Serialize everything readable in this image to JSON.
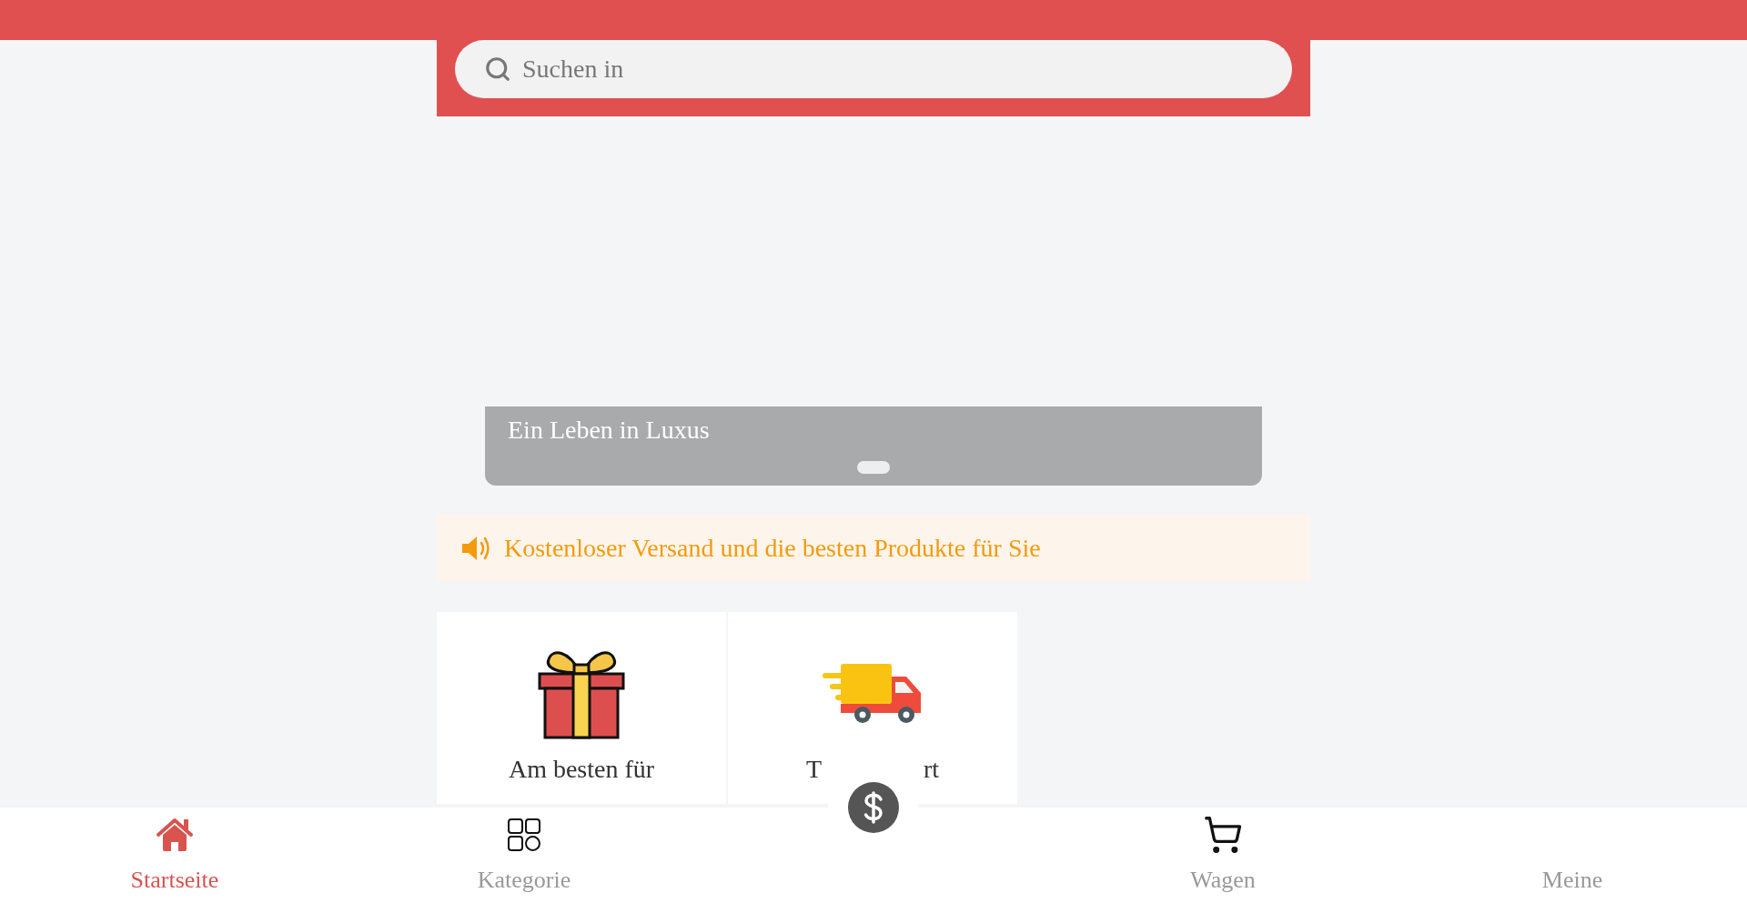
{
  "search": {
    "placeholder": "Suchen in"
  },
  "banner": {
    "caption": "Ein Leben in Luxus",
    "dots": [
      {
        "selected": true
      }
    ]
  },
  "notice": {
    "text": "Kostenloser Versand und die besten Produkte für Sie"
  },
  "cards": [
    {
      "kind": "gift",
      "label_fragments": [
        "Am besten für"
      ]
    },
    {
      "kind": "truck",
      "label_fragments": [
        "T",
        "rt"
      ]
    }
  ],
  "tabs": [
    {
      "kind": "home",
      "label": "Startseite",
      "selected": true
    },
    {
      "kind": "category",
      "label": "Kategorie",
      "selected": false
    },
    {
      "kind": "center",
      "selected": false
    },
    {
      "kind": "cart",
      "label": "Wagen",
      "selected": false
    },
    {
      "kind": "profile",
      "label": "Meine",
      "selected": false
    }
  ]
}
